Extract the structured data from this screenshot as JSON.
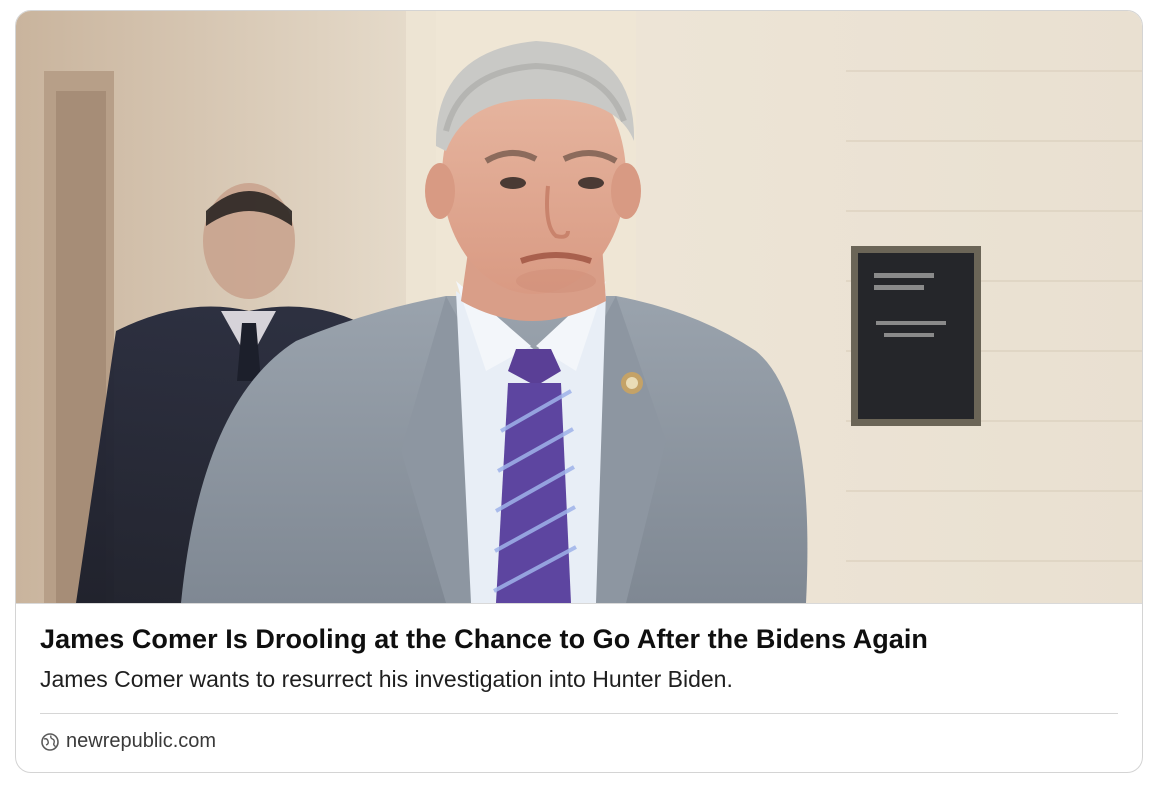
{
  "link_card": {
    "title": "James Comer Is Drooling at the Chance to Go After the Bidens Again",
    "description": "James Comer wants to resurrect his investigation into Hunter Biden.",
    "domain": "newrepublic.com",
    "image_icon": "photo-of-man-in-gray-suit",
    "source_icon": "globe-icon"
  }
}
